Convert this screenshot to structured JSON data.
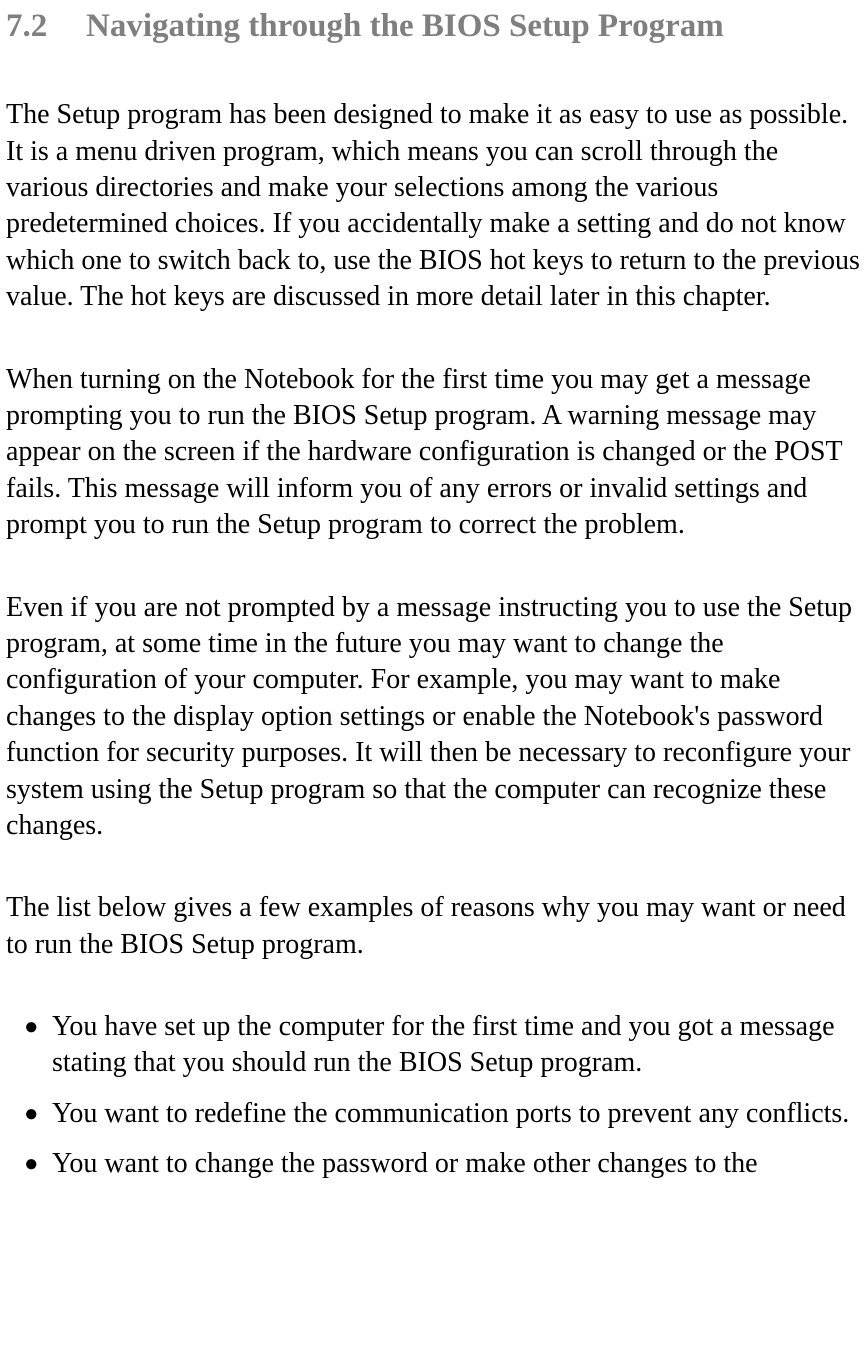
{
  "heading": {
    "number": "7.2",
    "title": "Navigating through the BIOS Setup Program"
  },
  "paragraphs": {
    "p1": "The Setup program has been designed to make it as easy to use as possible. It is a menu driven program, which means you can scroll through the various directories and make your selections among the various predetermined choices. If you accidentally make a setting and do not know which one to switch back to, use the BIOS hot keys to return to the previous value. The hot keys are discussed in more detail later in this chapter.",
    "p2": "When turning on the Notebook for the first time you may get a message prompting you to run the BIOS Setup program. A warning message may appear on the screen if the hardware configuration is changed or the POST fails. This message will inform you of any errors or invalid settings and prompt you to run the Setup program to correct the problem.",
    "p3": "Even if you are not prompted by a message instructing you to use the Setup program, at some time in the future you may want to change the configuration of your computer. For example, you may want to make changes to the display option settings or enable the Notebook's password function for security purposes. It will then be necessary to reconfigure your system using the Setup program so that the computer can recognize these changes.",
    "p4": "The list below gives a few examples of reasons why you may want or need to run the BIOS Setup program."
  },
  "list": {
    "items": [
      "You have set up the computer for the first time and you got a message stating that you should run the BIOS Setup program.",
      "You want to redefine the communication ports to prevent any conflicts.",
      "You want to change the password or make other changes to the"
    ]
  },
  "bullet_char": "●"
}
